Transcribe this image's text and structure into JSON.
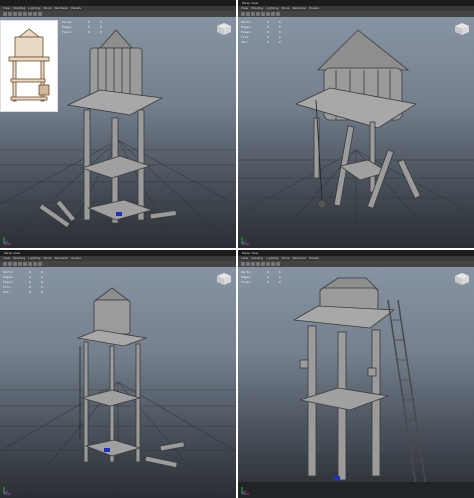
{
  "viewports": [
    {
      "title": "",
      "menus": [
        "View",
        "Shading",
        "Lighting",
        "Show",
        "Renderer",
        "Panels"
      ],
      "hud": [
        [
          "Verts:",
          "",
          "0",
          "0"
        ],
        [
          "Edges:",
          "",
          "0",
          "0"
        ],
        [
          "Faces:",
          "",
          "0",
          "0"
        ],
        [
          "Tris:",
          "",
          "0",
          "0"
        ],
        [
          "UVs:",
          "",
          "0",
          "0"
        ]
      ]
    },
    {
      "title": "Persp View",
      "menus": [
        "View",
        "Shading",
        "Lighting",
        "Show",
        "Renderer",
        "Panels"
      ],
      "hud": [
        [
          "Verts:",
          "",
          "0",
          "0"
        ],
        [
          "Edges:",
          "",
          "0",
          "0"
        ],
        [
          "Faces:",
          "",
          "0",
          "0"
        ],
        [
          "Tris:",
          "",
          "0",
          "0"
        ],
        [
          "UVs:",
          "",
          "0",
          "0"
        ]
      ]
    },
    {
      "title": "Persp View",
      "menus": [
        "View",
        "Shading",
        "Lighting",
        "Show",
        "Renderer",
        "Panels"
      ],
      "hud": [
        [
          "Verts:",
          "",
          "0",
          "0"
        ],
        [
          "Edges:",
          "",
          "0",
          "0"
        ],
        [
          "Faces:",
          "",
          "0",
          "0"
        ],
        [
          "Tris:",
          "",
          "0",
          "0"
        ],
        [
          "UVs:",
          "",
          "0",
          "0"
        ]
      ]
    },
    {
      "title": "Persp View",
      "menus": [
        "View",
        "Shading",
        "Lighting",
        "Show",
        "Renderer",
        "Panels"
      ],
      "hud": [
        [
          "Verts:",
          "",
          "0",
          "0"
        ],
        [
          "Edges:",
          "",
          "0",
          "0"
        ],
        [
          "Faces:",
          "",
          "0",
          "0"
        ],
        [
          "Tris:",
          "",
          "0",
          "0"
        ],
        [
          "UVs:",
          "",
          "0",
          "0"
        ]
      ]
    }
  ],
  "icons": {
    "view_cube": "view-cube-icon",
    "axis": "axis-gizmo-icon",
    "reference": "reference-sketch-image"
  },
  "colors": {
    "sky_top": "#8a97a6",
    "floor": "#2a2e34",
    "model": "#9a9a9a",
    "titlebar": "#1c1c1c"
  }
}
